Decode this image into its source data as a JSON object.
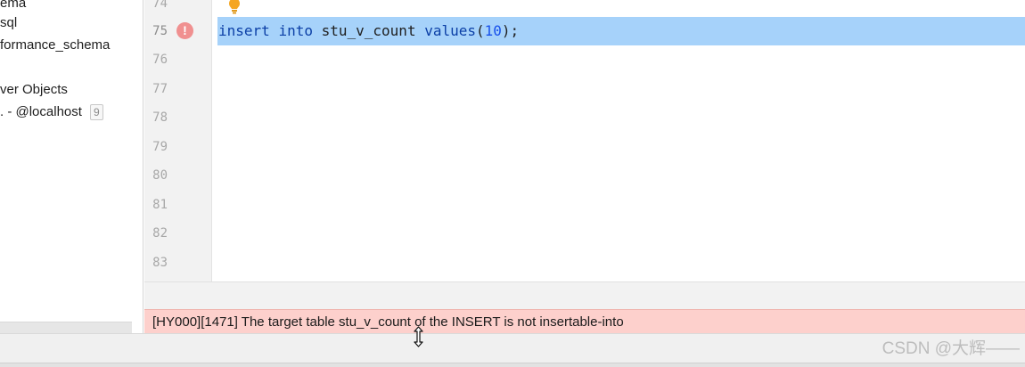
{
  "tree": {
    "items": [
      {
        "label": "ema"
      },
      {
        "label": "sql"
      },
      {
        "label": "formance_schema"
      },
      {
        "label": "ver Objects"
      },
      {
        "label": ". - @localhost",
        "count": "9"
      }
    ]
  },
  "editor": {
    "line_numbers": [
      "74",
      "75",
      "76",
      "77",
      "78",
      "79",
      "80",
      "81",
      "82",
      "83"
    ],
    "current_line": "75",
    "code": {
      "kw1": "insert",
      "kw2": "into",
      "table": "stu_v_count",
      "kw3": "values",
      "open_paren": "(",
      "value": "10",
      "close": ");"
    },
    "error_marker": "!"
  },
  "error_bar": {
    "message": "[HY000][1471] The target table stu_v_count of the INSERT is not insertable-into"
  },
  "watermark": "CSDN @大辉——",
  "icons": {
    "bulb": "lightbulb-icon",
    "error": "error-marker-icon",
    "cursor": "resize-cursor-icon"
  },
  "colors": {
    "selection": "#a6d2fa",
    "keyword": "#0b3fa6",
    "number": "#1750eb",
    "error_bar": "#fdd0cc",
    "error_marker": "#f09090",
    "bulb": "#f5a623"
  }
}
